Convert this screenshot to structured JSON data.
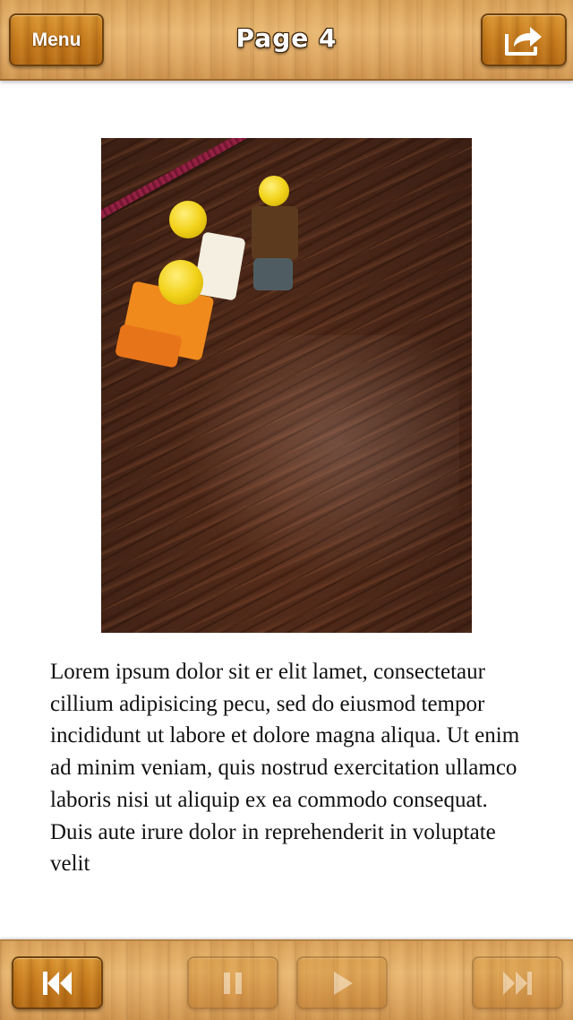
{
  "header": {
    "menu_label": "Menu",
    "page_title": "Page 4",
    "share_icon": "share-icon"
  },
  "content": {
    "photo_description_icon": "photo",
    "body_text": "Lorem ipsum dolor sit er elit lamet, consectetaur cillium adipisicing pecu, sed do eiusmod tempor incididunt ut labore et dolore magna aliqua. Ut enim ad minim veniam, quis nostrud exercitation ullamco laboris nisi ut aliquip ex ea commodo consequat. Duis aute irure dolor in reprehenderit in voluptate velit"
  },
  "controls": {
    "rewind_icon": "rewind-icon",
    "pause_icon": "pause-icon",
    "play_icon": "play-icon",
    "next_icon": "skip-next-icon",
    "pause_enabled": false,
    "play_enabled": false,
    "next_enabled": false
  },
  "colors": {
    "wood_light": "#e8b873",
    "wood_dark": "#c67a1c",
    "text": "#111111"
  }
}
